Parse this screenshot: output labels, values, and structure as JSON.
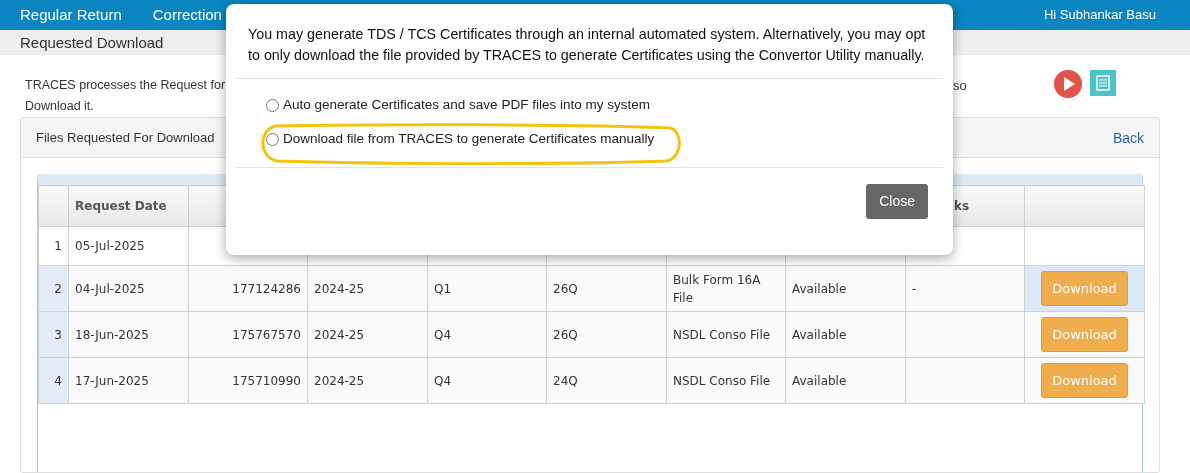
{
  "nav": {
    "items": [
      {
        "label": "Regular Return"
      },
      {
        "label": "Correction"
      }
    ],
    "greeting": "Hi Subhankar Basu"
  },
  "breadcrumb": "Requested Download",
  "intro": {
    "lines": [
      "TRACES processes the Request for",
      "Download it."
    ],
    "right_fragment": "so"
  },
  "panel": {
    "title": "Files Requested For Download",
    "back_link": "Back"
  },
  "table": {
    "headers": {
      "request_date": "Request Date",
      "column_8": "ks"
    },
    "rows": [
      {
        "index": "1",
        "request_date": "05-Jul-2025",
        "selected": false
      },
      {
        "index": "2",
        "request_date": "04-Jul-2025",
        "column_2": "177124286",
        "column_3": "2024-25",
        "column_4": "Q1",
        "column_5": "26Q",
        "column_6": "Bulk Form 16A File",
        "column_7": "Available",
        "column_8": "-",
        "action": "Download",
        "selected": true
      },
      {
        "index": "3",
        "request_date": "18-Jun-2025",
        "column_2": "175767570",
        "column_3": "2024-25",
        "column_4": "Q4",
        "column_5": "26Q",
        "column_6": "NSDL Conso File",
        "column_7": "Available",
        "action": "Download",
        "selected": false
      },
      {
        "index": "4",
        "request_date": "17-Jun-2025",
        "column_2": "175710990",
        "column_3": "2024-25",
        "column_4": "Q4",
        "column_5": "24Q",
        "column_6": "NSDL Conso File",
        "column_7": "Available",
        "action": "Download",
        "selected": false
      }
    ]
  },
  "modal": {
    "message": "You may generate TDS / TCS Certificates through an internal automated system. Alternatively, you may opt to only download the file provided by TRACES to generate Certificates using the Convertor Utility manually.",
    "options": [
      {
        "label": "Auto generate Certificates and save PDF files into my system",
        "checked": false,
        "highlighted": false
      },
      {
        "label": "Download file from TRACES to generate Certificates manually",
        "checked": false,
        "highlighted": true
      }
    ],
    "close_button": "Close"
  }
}
